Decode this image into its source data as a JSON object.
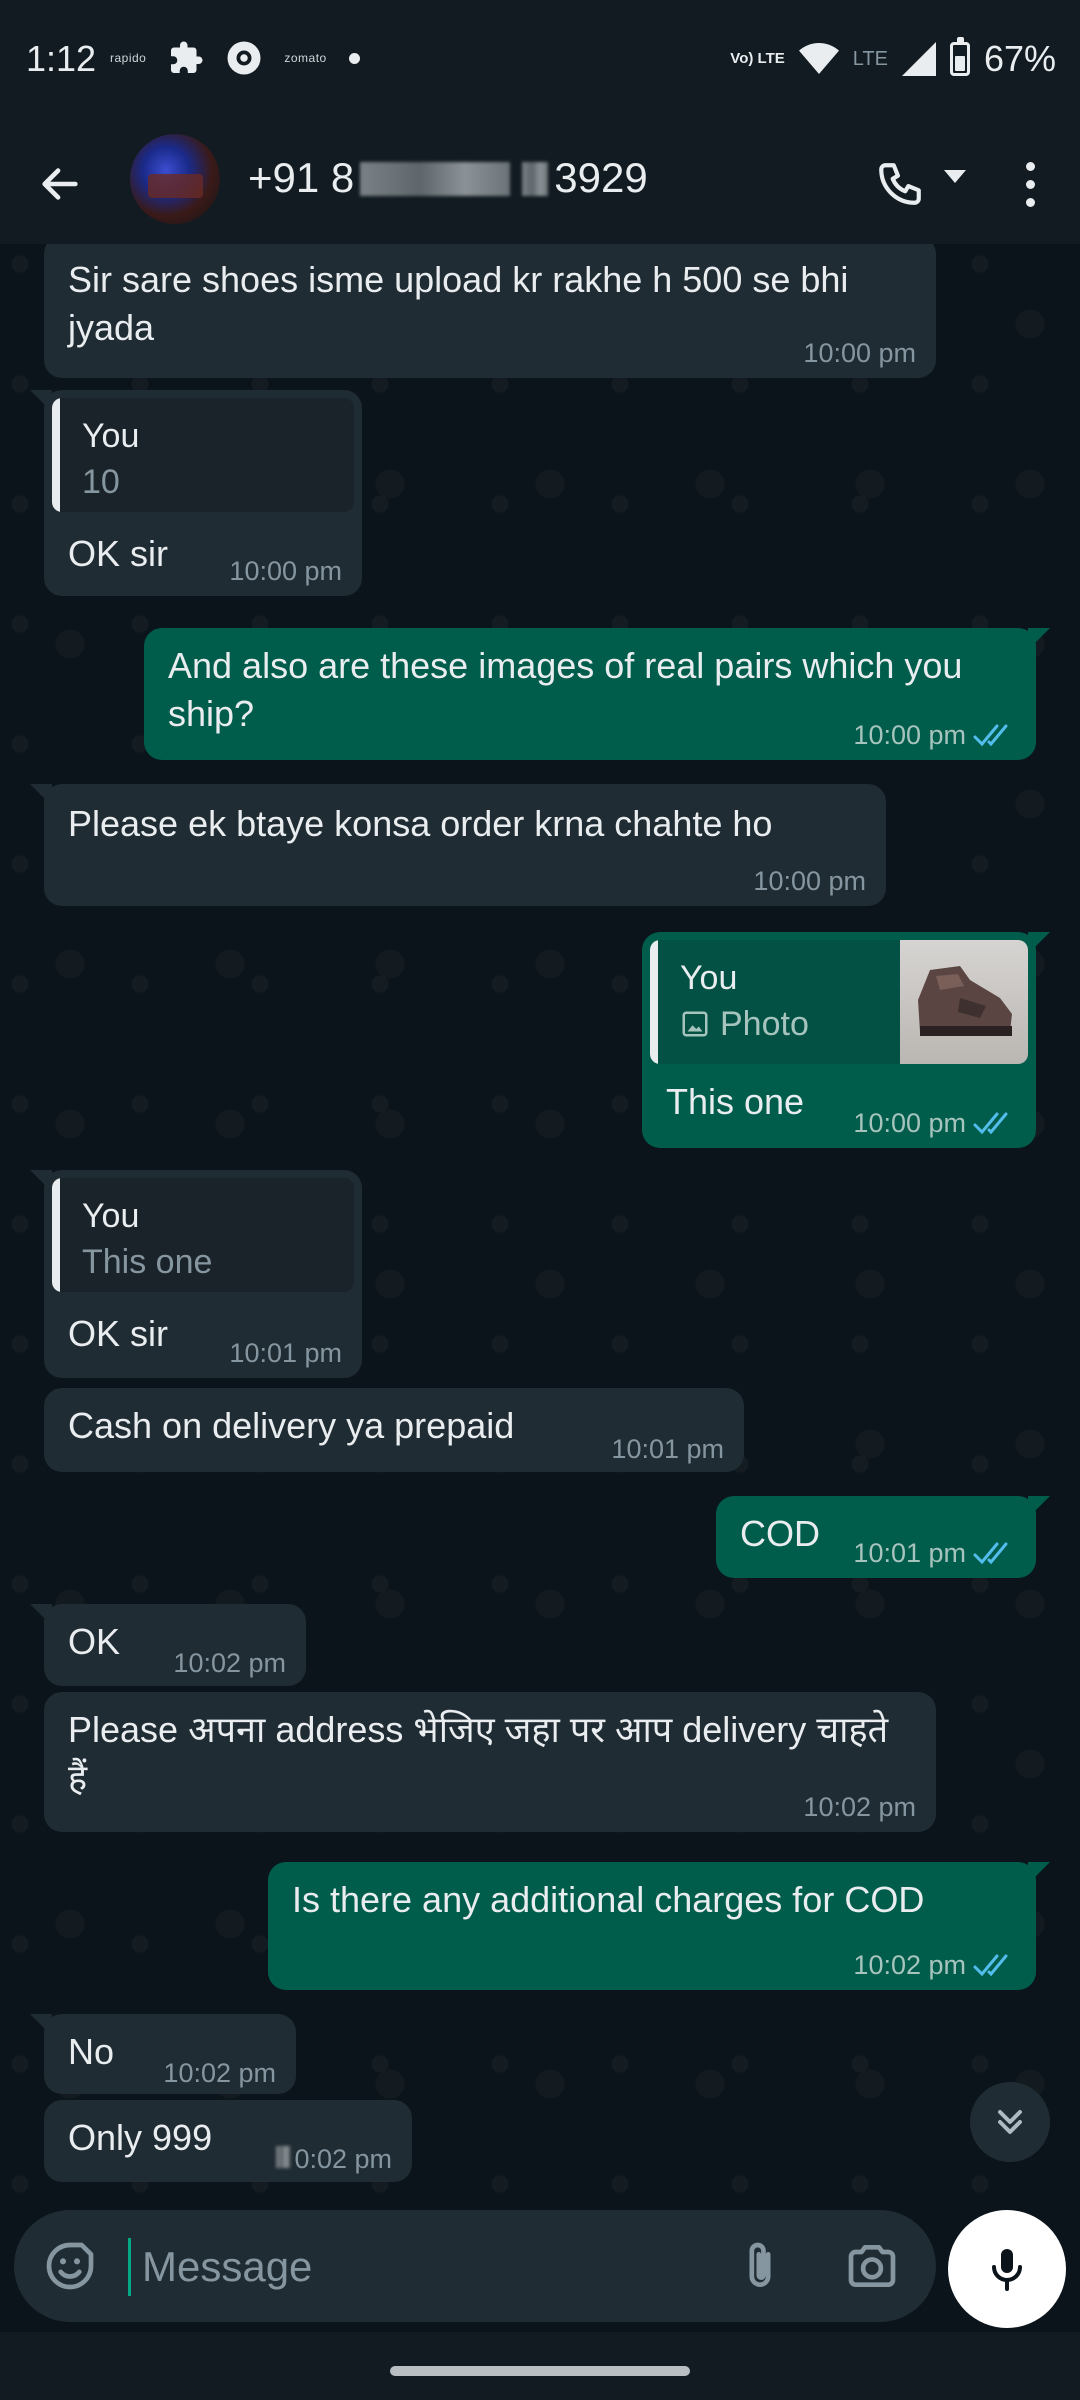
{
  "status_bar": {
    "time": "1:12",
    "apps": [
      "rapido",
      "zomato"
    ],
    "network": "Vo) LTE",
    "lte": "LTE",
    "battery": "67%",
    "battery_level": 0.67
  },
  "header": {
    "name_prefix": "+91 8",
    "name_suffix": "3929"
  },
  "messages": [
    {
      "text": "Sir sare shoes isme upload kr rakhe h 500 se bhi jyada",
      "time": "10:00 pm"
    },
    {
      "quote_author": "You",
      "quote_text": "10",
      "text": "OK sir",
      "time": "10:00 pm"
    },
    {
      "text": "And also are these images of real pairs which you ship?",
      "time": "10:00 pm"
    },
    {
      "text": "Please ek btaye konsa order krna chahte ho",
      "time": "10:00 pm"
    },
    {
      "quote_author": "You",
      "quote_text": "Photo",
      "text": "This one",
      "time": "10:00 pm"
    },
    {
      "quote_author": "You",
      "quote_text": "This one",
      "text": "OK sir",
      "time": "10:01 pm"
    },
    {
      "text": "Cash on delivery ya prepaid",
      "time": "10:01 pm"
    },
    {
      "text": "COD",
      "time": "10:01 pm"
    },
    {
      "text": "OK",
      "time": "10:02 pm"
    },
    {
      "text": "Please अपना address भेजिए जहा पर आप delivery चाहते हैं",
      "time": "10:02 pm"
    },
    {
      "text": "Is there any additional charges for COD",
      "time": "10:02 pm"
    },
    {
      "text": "No",
      "time": "10:02 pm"
    },
    {
      "text": "Only 999",
      "time": "0:02 pm"
    }
  ],
  "input": {
    "placeholder": "Message"
  },
  "colors": {
    "background": "#0b141a",
    "incoming_bubble": "#202c33",
    "outgoing_bubble": "#005c4b",
    "read_ticks": "#53bdeb",
    "accent": "#00a884"
  }
}
